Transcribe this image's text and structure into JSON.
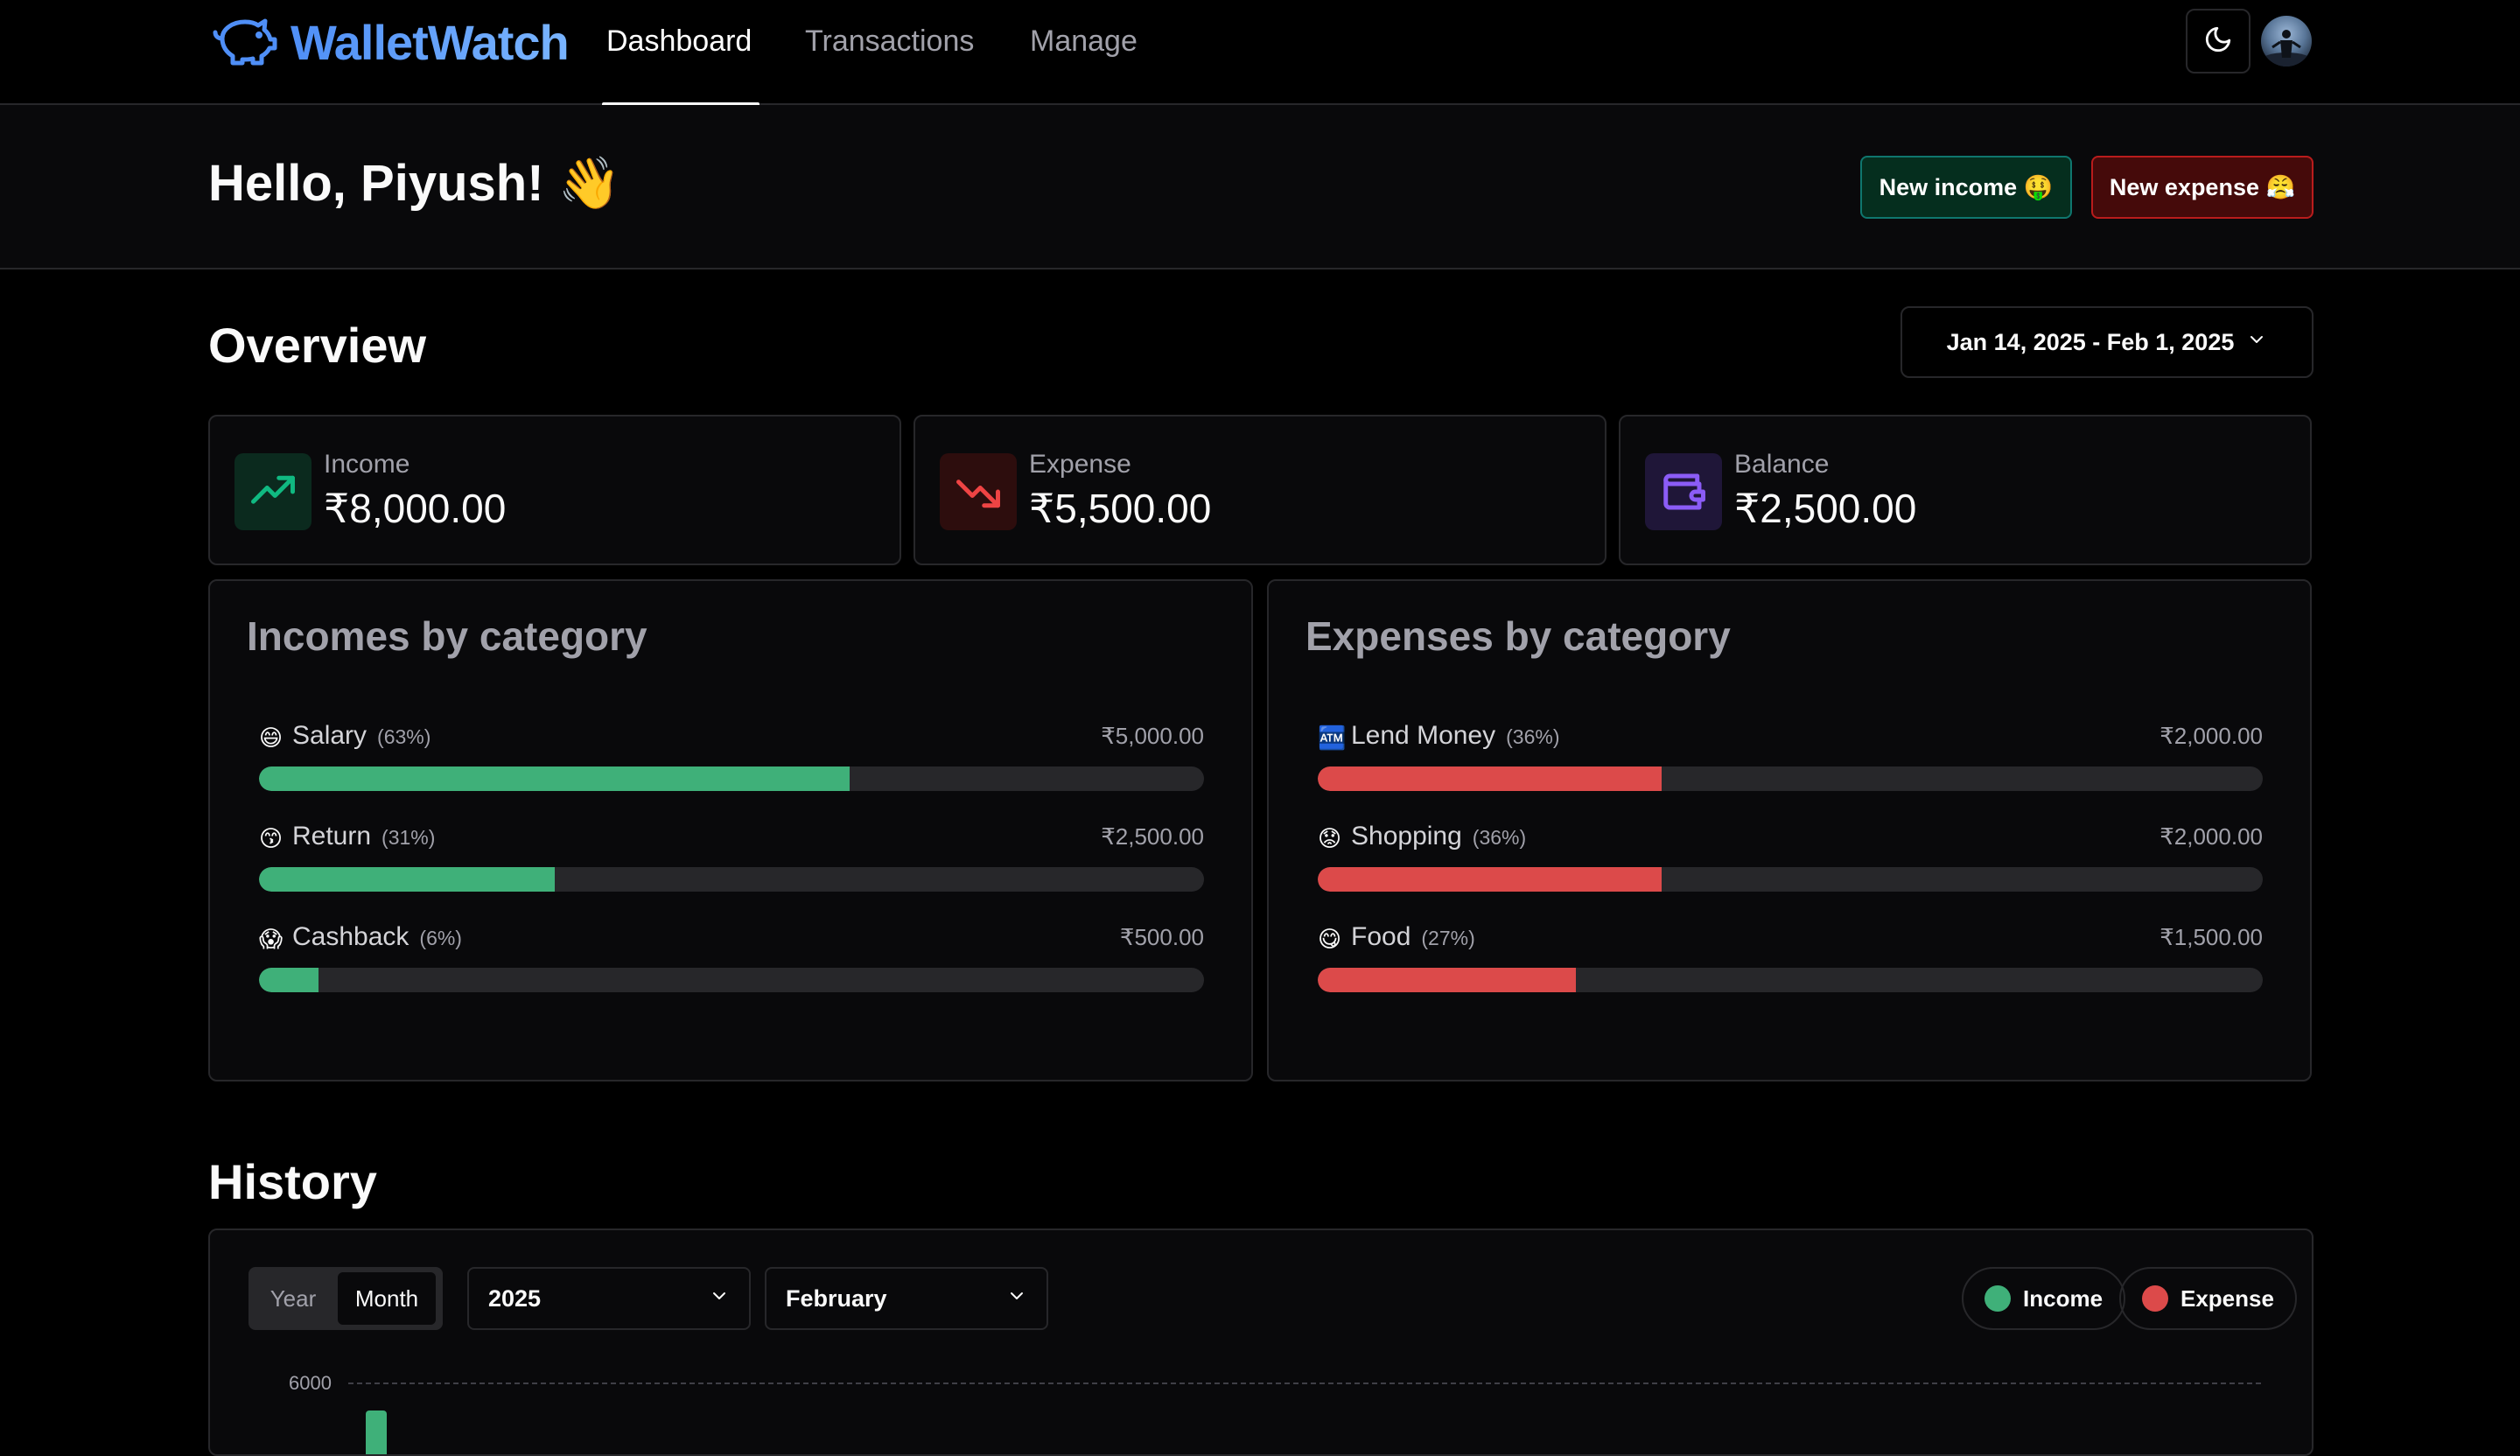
{
  "app": {
    "name": "WalletWatch"
  },
  "nav": {
    "links": [
      {
        "label": "Dashboard",
        "active": true
      },
      {
        "label": "Transactions",
        "active": false
      },
      {
        "label": "Manage",
        "active": false
      }
    ],
    "theme_icon": "moon-icon",
    "avatar": "user-avatar"
  },
  "header": {
    "greeting": "Hello, Piyush! 👋",
    "new_income": "New income 🤑",
    "new_expense": "New expense 😤"
  },
  "overview": {
    "title": "Overview",
    "date_range": "Jan 14, 2025 - Feb 1, 2025",
    "stats": [
      {
        "label": "Income",
        "value": "₹8,000.00",
        "icon": "trending-up-icon",
        "color": "#10b981"
      },
      {
        "label": "Expense",
        "value": "₹5,500.00",
        "icon": "trending-down-icon",
        "color": "#ef4444"
      },
      {
        "label": "Balance",
        "value": "₹2,500.00",
        "icon": "wallet-icon",
        "color": "#8b5cf6"
      }
    ]
  },
  "income_categories": {
    "title": "Incomes by category",
    "items": [
      {
        "emoji": "😄",
        "name": "Salary",
        "pct": "(63%)",
        "amount": "₹5,000.00",
        "ratio": 0.625
      },
      {
        "emoji": "😙",
        "name": "Return",
        "pct": "(31%)",
        "amount": "₹2,500.00",
        "ratio": 0.3125
      },
      {
        "emoji": "😱",
        "name": "Cashback",
        "pct": "(6%)",
        "amount": "₹500.00",
        "ratio": 0.0625
      }
    ],
    "color": "#3fb079"
  },
  "expense_categories": {
    "title": "Expenses by category",
    "items": [
      {
        "emoji": "🏧",
        "name": "Lend Money",
        "pct": "(36%)",
        "amount": "₹2,000.00",
        "ratio": 0.3636
      },
      {
        "emoji": "😟",
        "name": "Shopping",
        "pct": "(36%)",
        "amount": "₹2,000.00",
        "ratio": 0.3636
      },
      {
        "emoji": "😋",
        "name": "Food",
        "pct": "(27%)",
        "amount": "₹1,500.00",
        "ratio": 0.2727
      }
    ],
    "color": "#dc4a4a"
  },
  "history": {
    "title": "History",
    "period_tabs": [
      "Year",
      "Month"
    ],
    "active_period": "Month",
    "year": "2025",
    "month": "February",
    "legend": [
      {
        "label": "Income",
        "color": "#3fb079"
      },
      {
        "label": "Expense",
        "color": "#dc4a4a"
      }
    ],
    "y_tick": "6000"
  }
}
